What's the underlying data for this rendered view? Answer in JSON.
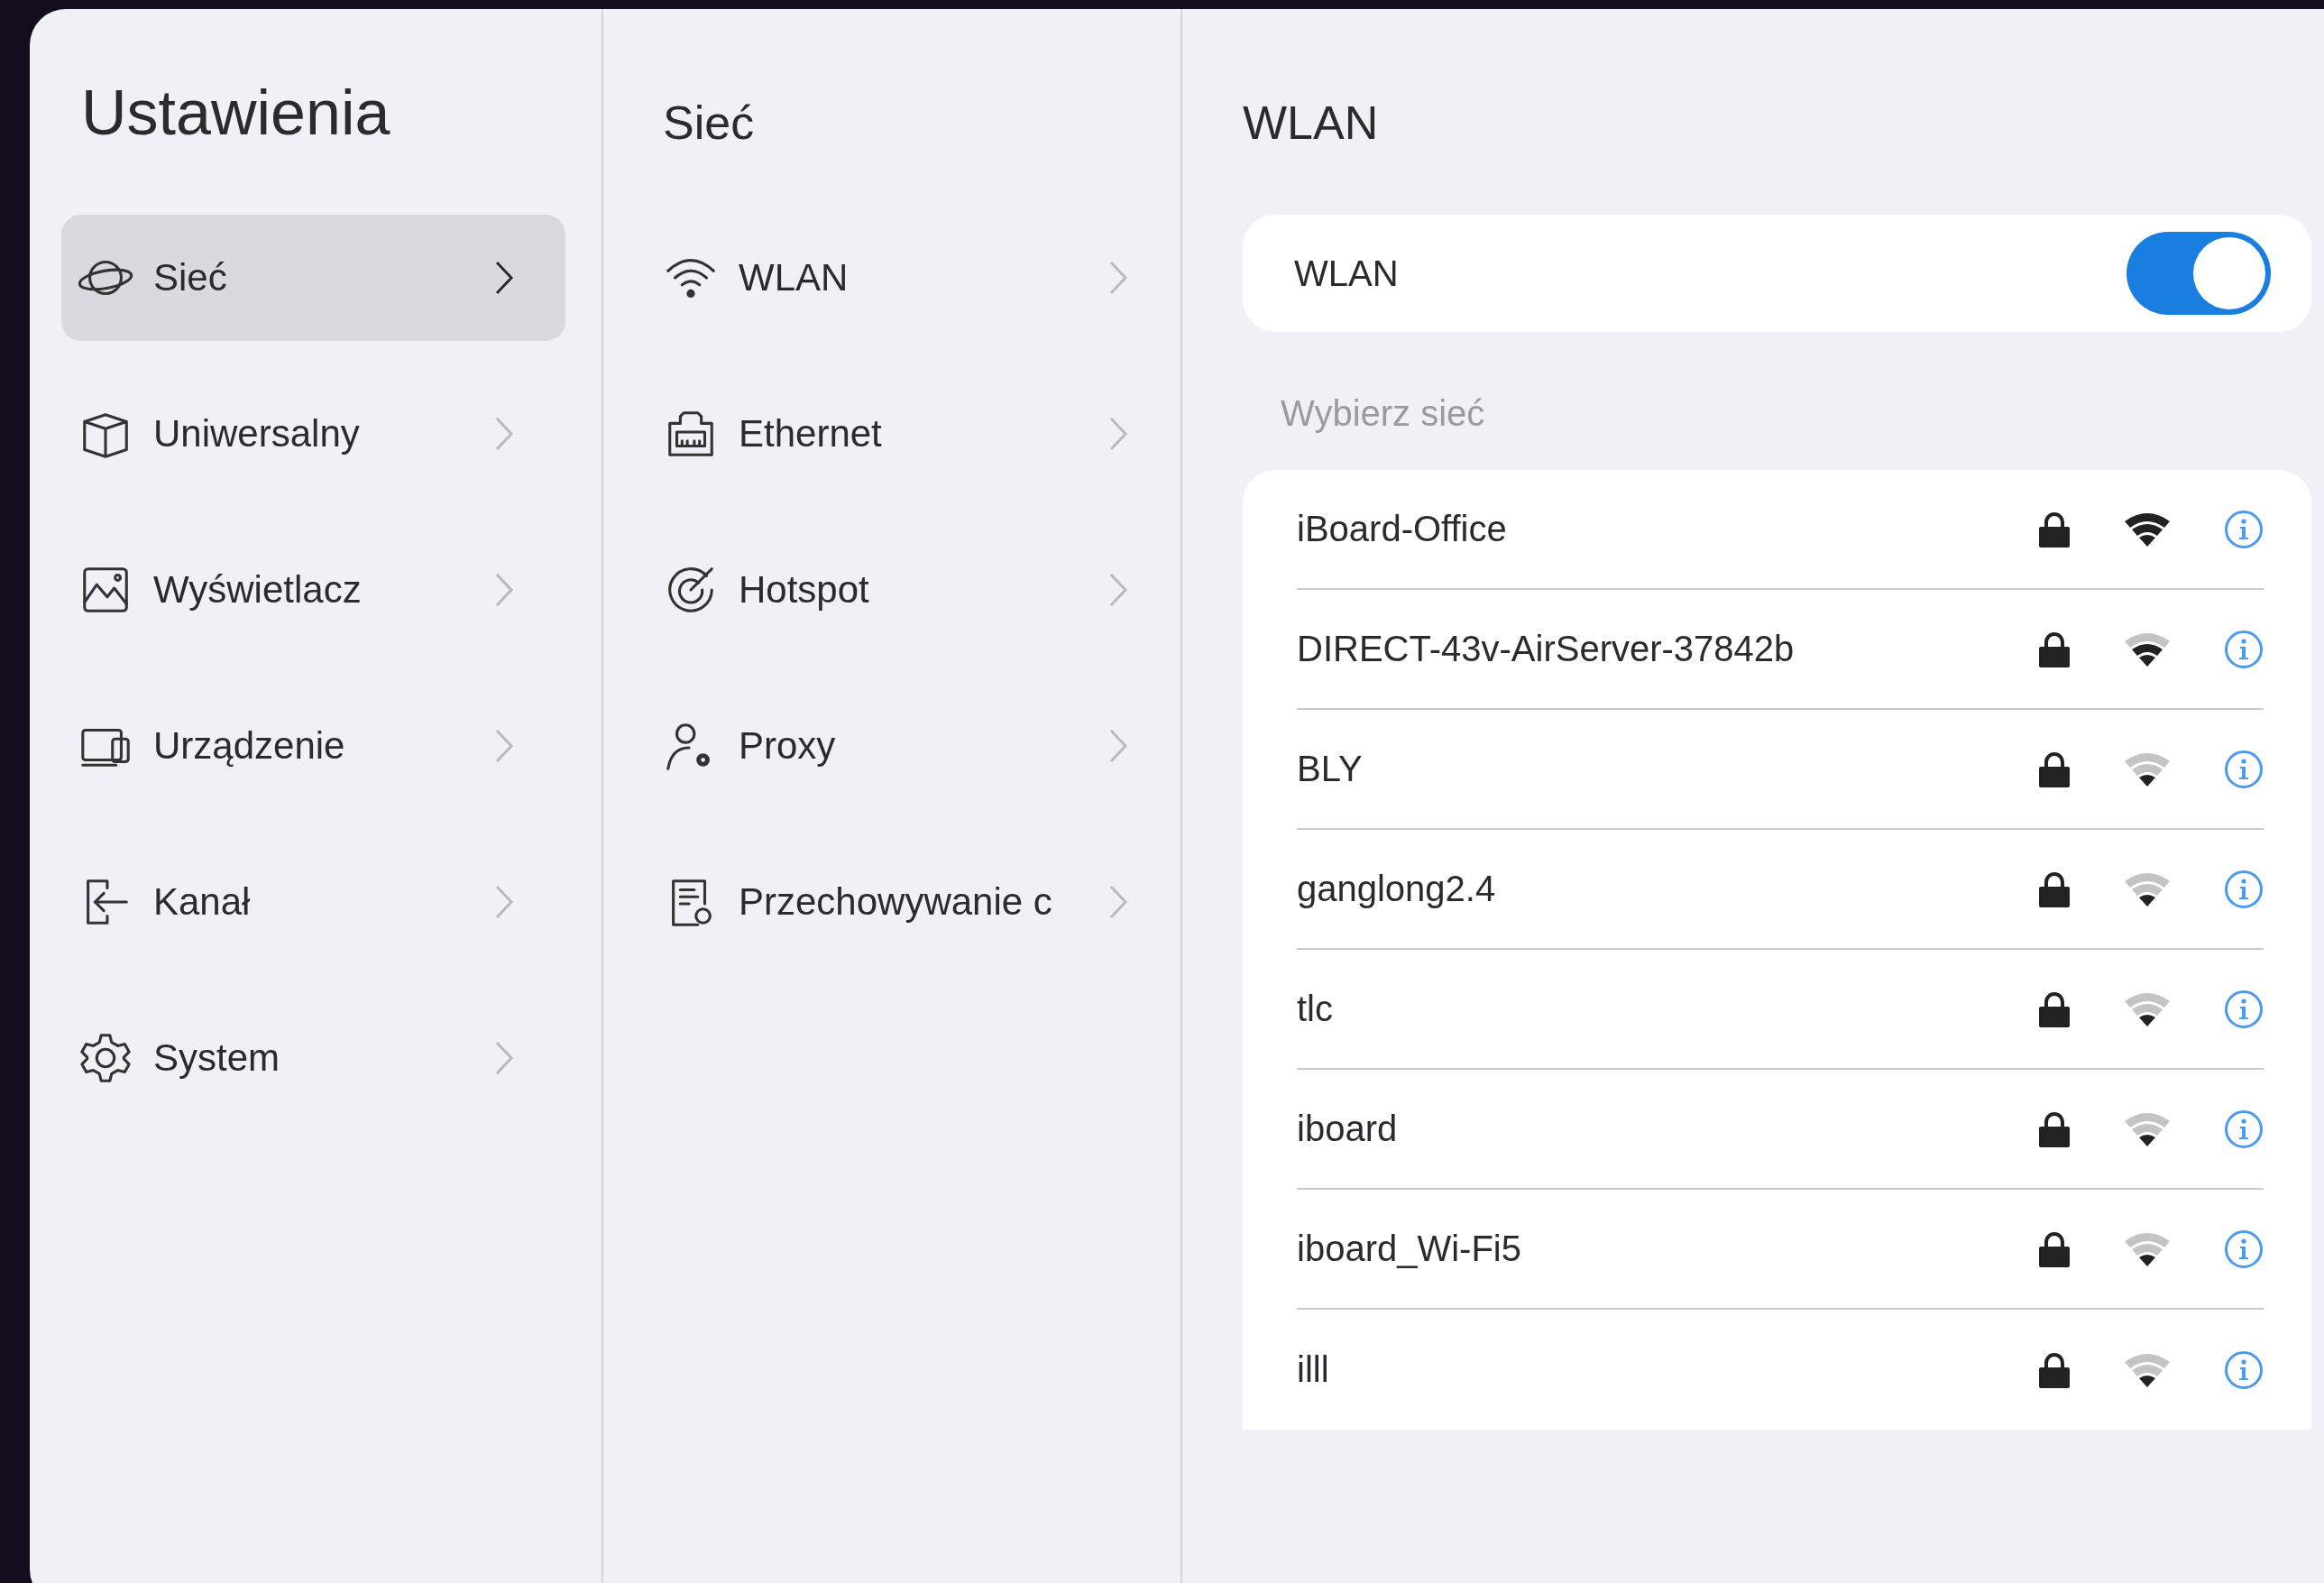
{
  "sidebar": {
    "title": "Ustawienia",
    "items": [
      {
        "label": "Sieć",
        "selected": true
      },
      {
        "label": "Uniwersalny",
        "selected": false
      },
      {
        "label": "Wyświetlacz",
        "selected": false
      },
      {
        "label": "Urządzenie",
        "selected": false
      },
      {
        "label": "Kanał",
        "selected": false
      },
      {
        "label": "System",
        "selected": false
      }
    ]
  },
  "submenu": {
    "title": "Sieć",
    "items": [
      {
        "label": "WLAN"
      },
      {
        "label": "Ethernet"
      },
      {
        "label": "Hotspot"
      },
      {
        "label": "Proxy"
      },
      {
        "label": "Przechowywanie c"
      }
    ]
  },
  "detail": {
    "title": "WLAN",
    "toggle": {
      "label": "WLAN",
      "on": true
    },
    "section_label": "Wybierz sieć",
    "networks": [
      {
        "name": "iBoard-Office",
        "kind": "full",
        "locked": true
      },
      {
        "name": "DIRECT-43v-AirServer-37842b",
        "kind": "good",
        "locked": true
      },
      {
        "name": "BLY",
        "kind": "fair",
        "locked": true
      },
      {
        "name": "ganglong2.4",
        "kind": "fair",
        "locked": true
      },
      {
        "name": "tlc",
        "kind": "fair",
        "locked": true
      },
      {
        "name": "iboard",
        "kind": "fair",
        "locked": true
      },
      {
        "name": "iboard_Wi-Fi5",
        "kind": "fair",
        "locked": true
      },
      {
        "name": "illl",
        "kind": "fair",
        "locked": true
      }
    ]
  }
}
